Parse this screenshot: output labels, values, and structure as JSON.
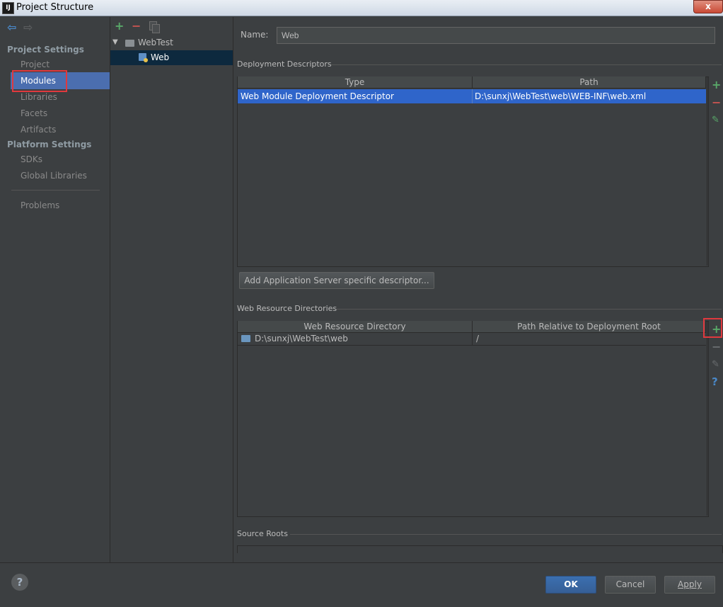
{
  "window": {
    "title": "Project Structure",
    "app_icon": "IJ",
    "close": "x"
  },
  "nav": {
    "back_icon": "back-arrow-icon",
    "forward_icon": "forward-arrow-icon",
    "project_settings_heading": "Project Settings",
    "project_settings_items": [
      "Project",
      "Modules",
      "Libraries",
      "Facets",
      "Artifacts"
    ],
    "platform_settings_heading": "Platform Settings",
    "platform_settings_items": [
      "SDKs",
      "Global Libraries"
    ],
    "problems": "Problems",
    "selected": "Modules"
  },
  "tree": {
    "toolbar": {
      "add": "+",
      "remove": "−",
      "copy_icon": "copy-icon"
    },
    "root": "WebTest",
    "child": "Web"
  },
  "module": {
    "name_label": "Name:",
    "name_value": "Web"
  },
  "deployment": {
    "title": "Deployment Descriptors",
    "columns": [
      "Type",
      "Path"
    ],
    "rows": [
      {
        "type": "Web Module Deployment Descriptor",
        "path": "D:\\sunxj\\WebTest\\web\\WEB-INF\\web.xml"
      }
    ],
    "add_server_button": "Add Application Server specific descriptor..."
  },
  "web_resources": {
    "title": "Web Resource Directories",
    "columns": [
      "Web Resource Directory",
      "Path Relative to Deployment Root"
    ],
    "rows": [
      {
        "directory": "D:\\sunxj\\WebTest\\web",
        "relative": "/"
      }
    ],
    "help": "?"
  },
  "source_roots": {
    "title": "Source Roots"
  },
  "footer": {
    "help": "?",
    "ok": "OK",
    "cancel": "Cancel",
    "apply": "Apply"
  },
  "colors": {
    "accent": "#4b6eaf",
    "selection": "#2f65ca",
    "add_green": "#59a869",
    "remove_red": "#c75450",
    "highlight_red": "#e0393e"
  }
}
